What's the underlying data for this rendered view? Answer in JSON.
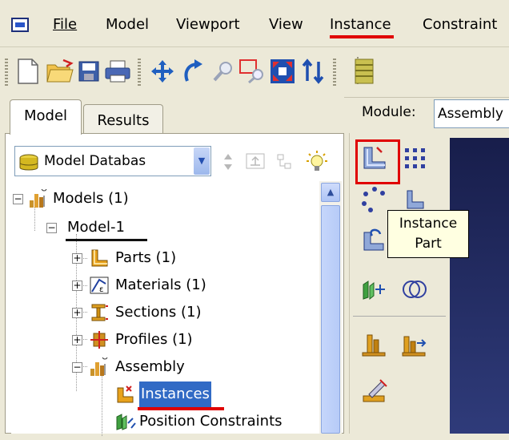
{
  "menubar": {
    "items": [
      {
        "label": "File"
      },
      {
        "label": "Model"
      },
      {
        "label": "Viewport"
      },
      {
        "label": "View"
      },
      {
        "label": "Instance"
      },
      {
        "label": "Constraint"
      }
    ]
  },
  "tabs": [
    {
      "label": "Model",
      "active": true
    },
    {
      "label": "Results",
      "active": false
    }
  ],
  "database_selector": {
    "value": "Model Databas"
  },
  "module": {
    "label": "Module:",
    "value": "Assembly"
  },
  "tree": {
    "root": {
      "label": "Models (1)",
      "expanded": true
    },
    "model": {
      "label": "Model-1",
      "expanded": true
    },
    "children": [
      {
        "label": "Parts (1)",
        "icon": "part-icon",
        "expanded": false
      },
      {
        "label": "Materials (1)",
        "icon": "material-icon",
        "expanded": false
      },
      {
        "label": "Sections (1)",
        "icon": "section-icon",
        "expanded": false
      },
      {
        "label": "Profiles (1)",
        "icon": "profile-icon",
        "expanded": false
      },
      {
        "label": "Assembly",
        "icon": "assembly-icon",
        "expanded": true
      }
    ],
    "assembly_children": [
      {
        "label": "Instances",
        "icon": "instance-icon",
        "selected": true
      },
      {
        "label": "Position Constraints",
        "icon": "constraint-icon",
        "selected": false
      }
    ]
  },
  "tooltip": {
    "line1": "Instance",
    "line2": "Part"
  },
  "colors": {
    "highlight": "#e00000",
    "selection": "#316ac5",
    "viewport": "#1f2760"
  }
}
